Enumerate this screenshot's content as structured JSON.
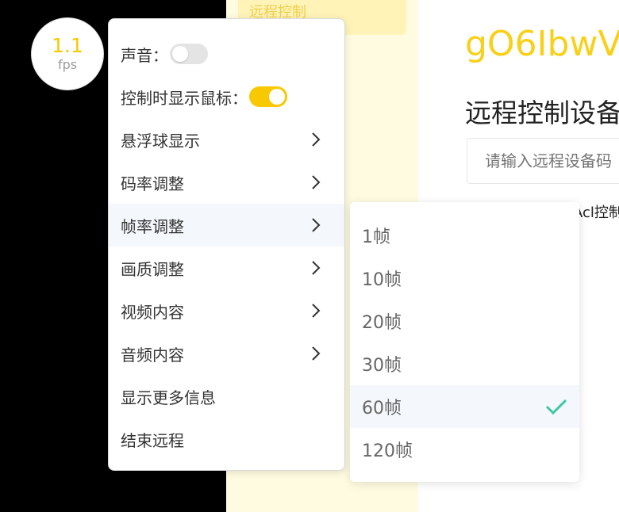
{
  "background": {
    "sidebar_nav_label": "远程控制",
    "device_code": "gO6IbwV",
    "section_title": "远程控制设备",
    "device_input_placeholder": "请输入远程设备码",
    "acl_text": "Acl控制"
  },
  "fps_badge": {
    "value": "1.1",
    "unit": "fps"
  },
  "menu": {
    "sound_label": "声音：",
    "sound_on": false,
    "show_cursor_label": "控制时显示鼠标：",
    "show_cursor_on": true,
    "items": [
      {
        "label": "悬浮球显示",
        "has_submenu": true
      },
      {
        "label": "码率调整",
        "has_submenu": true
      },
      {
        "label": "帧率调整",
        "has_submenu": true,
        "active": true
      },
      {
        "label": "画质调整",
        "has_submenu": true
      },
      {
        "label": "视频内容",
        "has_submenu": true
      },
      {
        "label": "音频内容",
        "has_submenu": true
      },
      {
        "label": "显示更多信息",
        "has_submenu": false
      },
      {
        "label": "结束远程",
        "has_submenu": false
      }
    ]
  },
  "framerate_submenu": {
    "options": [
      "1帧",
      "10帧",
      "20帧",
      "30帧",
      "60帧",
      "120帧"
    ],
    "selected": "60帧"
  },
  "colors": {
    "accent_yellow": "#f8c800",
    "check_green": "#3fc7a4",
    "sidebar_bg": "#fffbe0"
  },
  "icons": {
    "chevron": "chevron-right-icon",
    "check": "check-icon"
  }
}
